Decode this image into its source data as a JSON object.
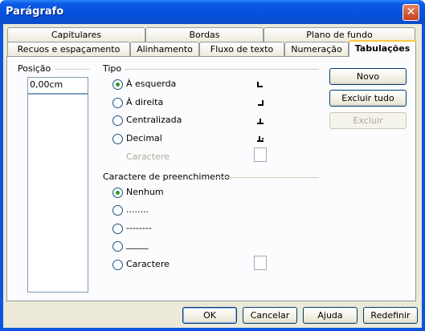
{
  "window": {
    "title": "Parágrafo",
    "close_label": "✕"
  },
  "tabs_row1": [
    {
      "label": "Capitulares"
    },
    {
      "label": "Bordas"
    },
    {
      "label": "Plano de fundo"
    }
  ],
  "tabs_row2": [
    {
      "label": "Recuos e espaçamento"
    },
    {
      "label": "Alinhamento"
    },
    {
      "label": "Fluxo de texto"
    },
    {
      "label": "Numeração"
    },
    {
      "label": "Tabulações"
    }
  ],
  "position": {
    "label": "Posição",
    "value": "0,00cm"
  },
  "type": {
    "label": "Tipo",
    "options": [
      {
        "label": "À esquerda",
        "checked": true
      },
      {
        "label": "À direita",
        "checked": false
      },
      {
        "label": "Centralizada",
        "checked": false
      },
      {
        "label": "Decimal",
        "checked": false
      }
    ],
    "character_label": "Caractere"
  },
  "fill": {
    "label": "Caractere de preenchimento",
    "options": [
      {
        "label": "Nenhum",
        "checked": true
      },
      {
        "label": "........",
        "checked": false
      },
      {
        "label": "--------",
        "checked": false
      },
      {
        "label": "_____",
        "checked": false
      },
      {
        "label": "Caractere",
        "checked": false
      }
    ]
  },
  "side_buttons": {
    "new": "Novo",
    "delete_all": "Excluir tudo",
    "delete": "Excluir"
  },
  "footer": {
    "ok": "OK",
    "cancel": "Cancelar",
    "help": "Ajuda",
    "reset": "Redefinir"
  }
}
